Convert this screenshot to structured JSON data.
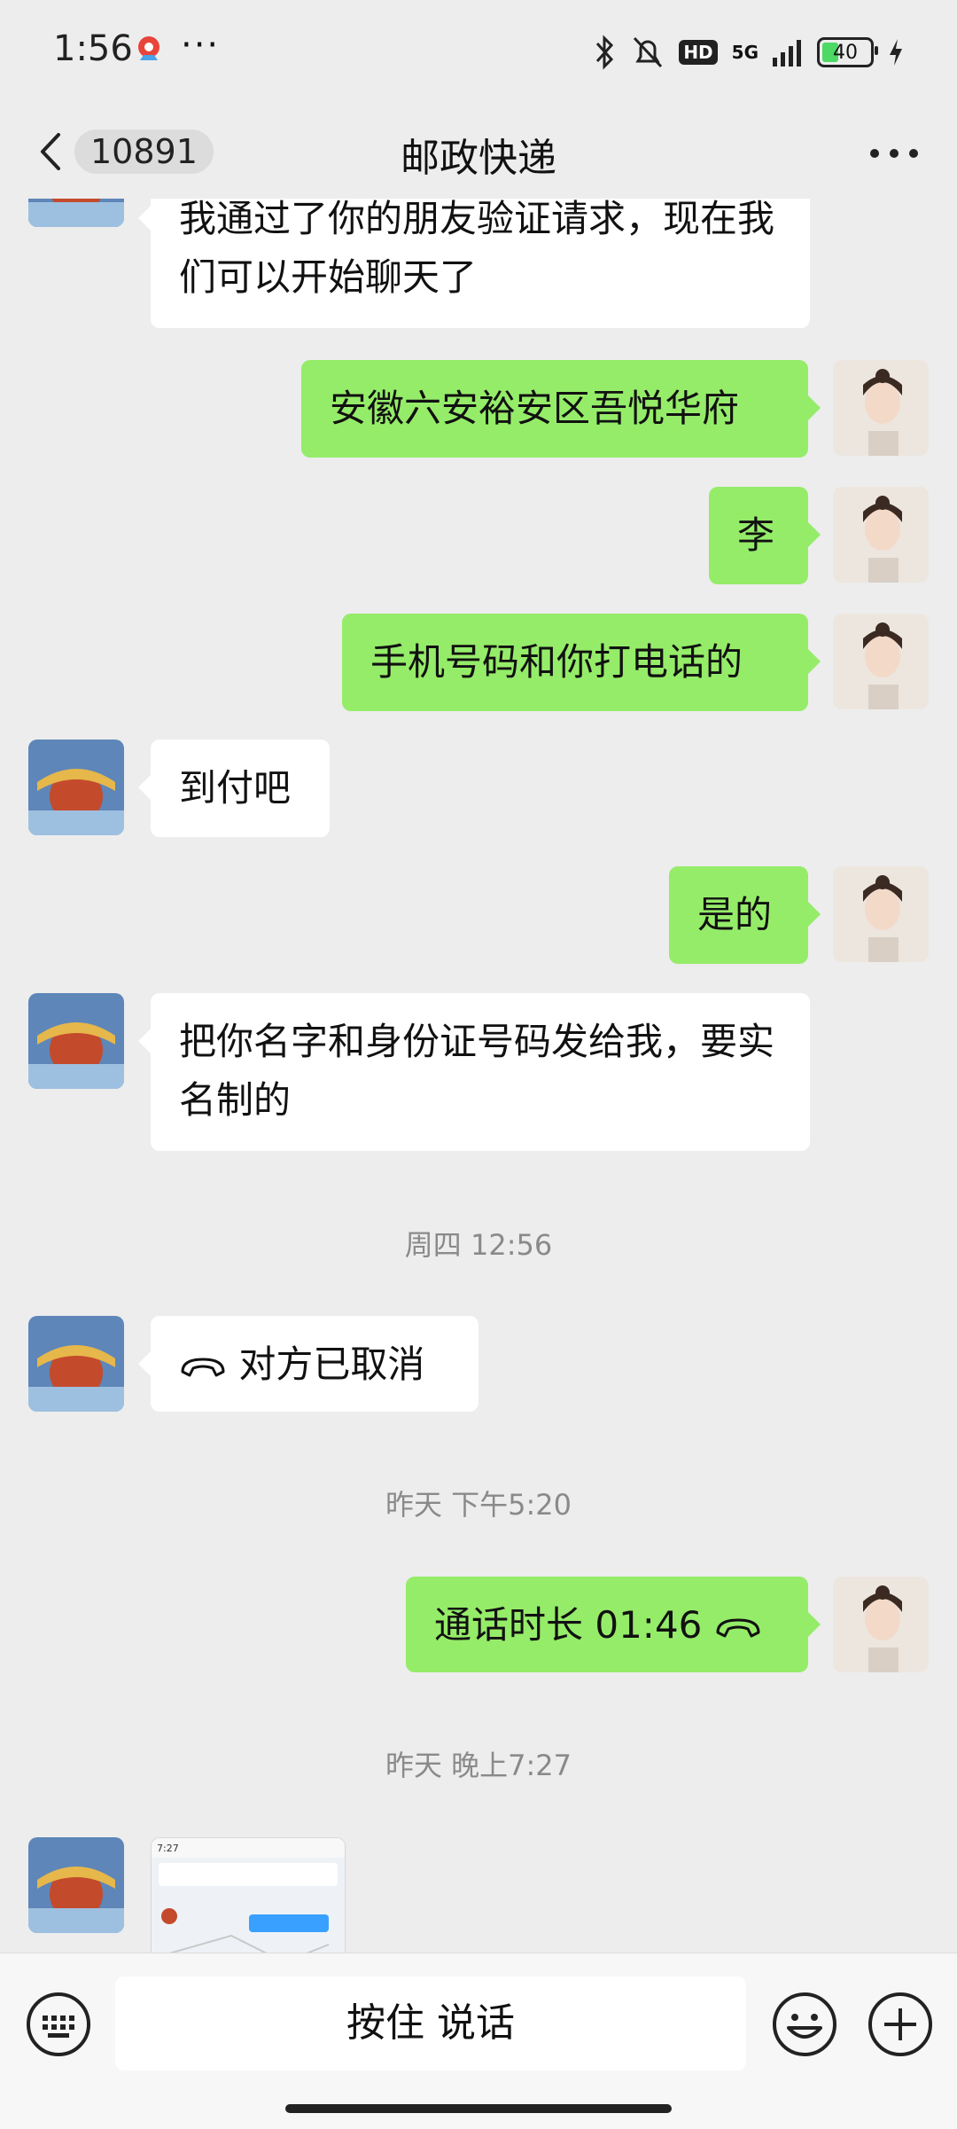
{
  "status_bar": {
    "time": "1:56",
    "more": "···",
    "network": "5G",
    "battery": "40"
  },
  "header": {
    "unread_count": "10891",
    "title": "邮政快递"
  },
  "messages": [
    {
      "side": "other",
      "text": "我通过了你的朋友验证请求，现在我们可以开始聊天了"
    },
    {
      "side": "self",
      "text": "安徽六安裕安区吾悦华府"
    },
    {
      "side": "self",
      "text": "李"
    },
    {
      "side": "self",
      "text": "手机号码和你打电话的"
    },
    {
      "side": "other",
      "text": "到付吧"
    },
    {
      "side": "self",
      "text": "是的"
    },
    {
      "side": "other",
      "text": "把你名字和身份证号码发给我，要实名制的"
    },
    {
      "type": "timestamp",
      "text": "周四 12:56"
    },
    {
      "side": "other",
      "type": "call",
      "text": "对方已取消"
    },
    {
      "type": "timestamp",
      "text": "昨天 下午5:20"
    },
    {
      "side": "self",
      "type": "call",
      "text": "通话时长 01:46"
    },
    {
      "type": "timestamp",
      "text": "昨天 晚上7:27"
    },
    {
      "side": "other",
      "type": "image",
      "text": "7:27"
    }
  ],
  "input_bar": {
    "hold_to_talk": "按住 说话"
  },
  "colors": {
    "self_bubble": "#95ec69",
    "other_bubble": "#ffffff",
    "background": "#ededed"
  }
}
